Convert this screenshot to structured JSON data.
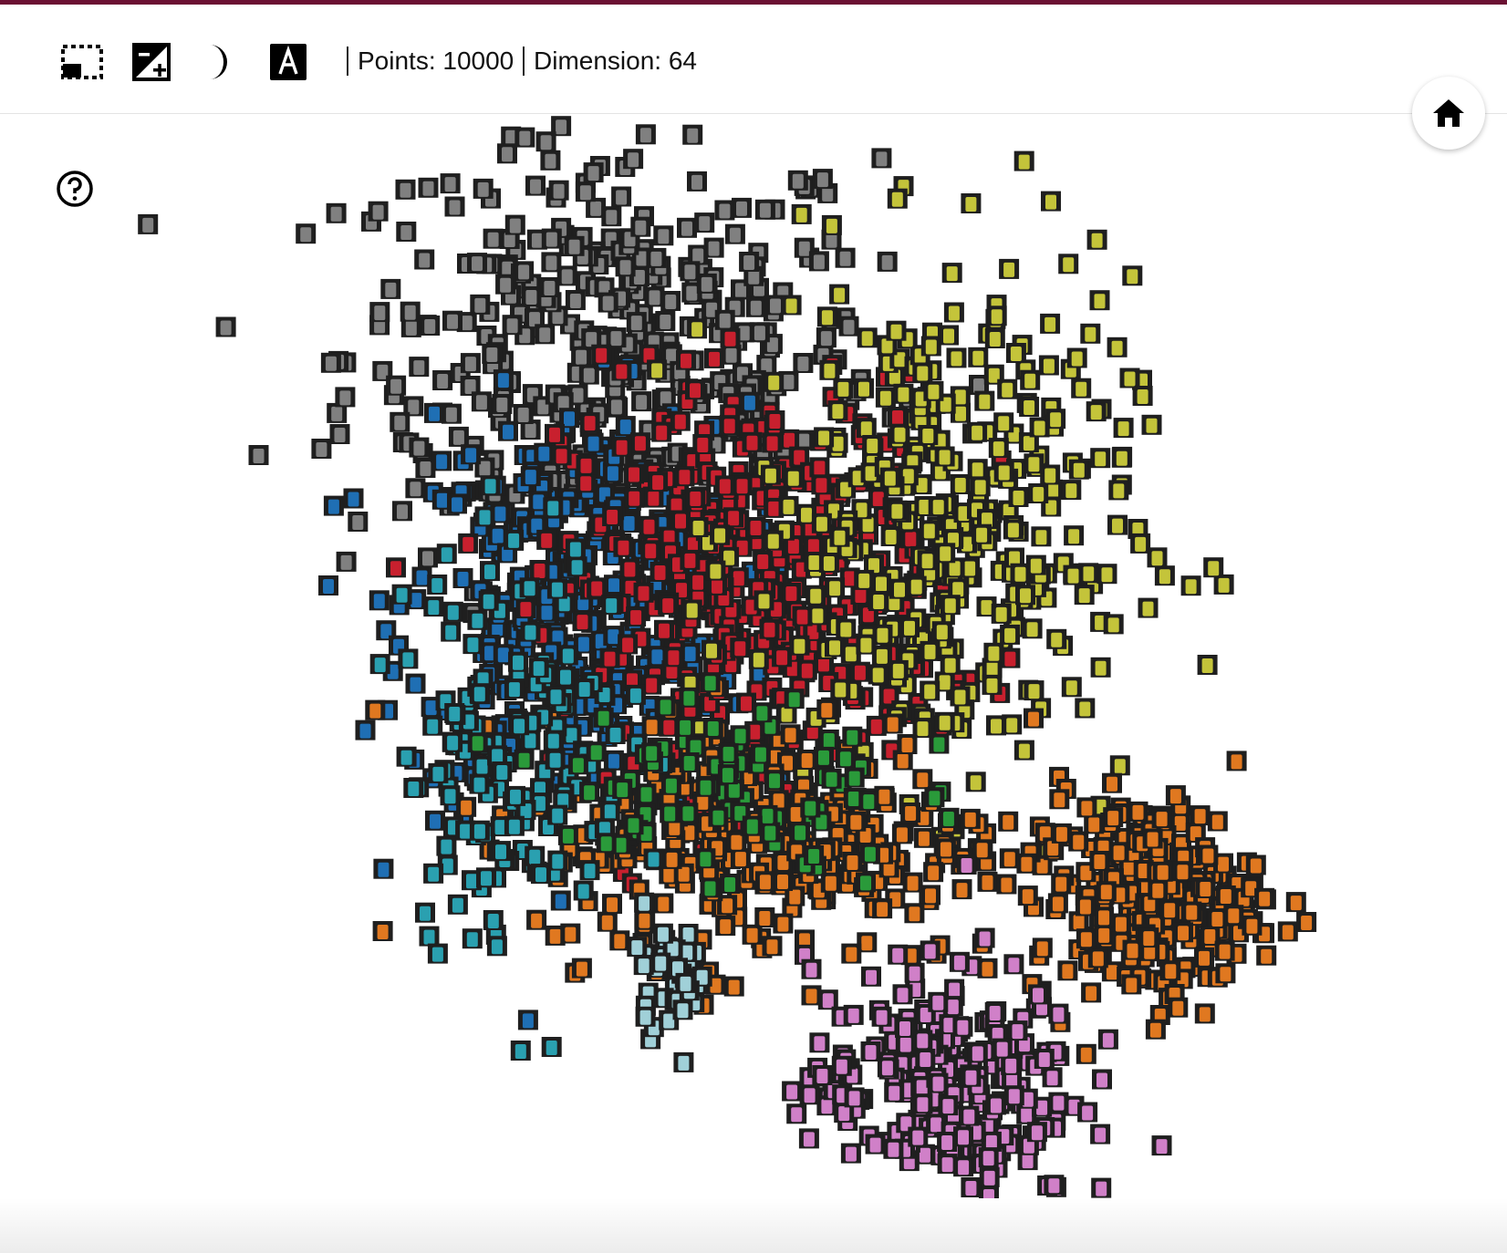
{
  "toolbar": {
    "buttons": [
      {
        "name": "select-region",
        "icon": "dashed-rectangle-icon"
      },
      {
        "name": "toggle-contrast",
        "icon": "exposure-plus-icon"
      },
      {
        "name": "night-mode",
        "icon": "crescent-moon-icon"
      },
      {
        "name": "toggle-labels",
        "icon": "label-a-icon"
      }
    ],
    "points_label": "Points: 10000",
    "dimension_label": "Dimension: 64"
  },
  "home_button": {
    "icon": "home-icon"
  },
  "help_button": {
    "icon": "help-circle-icon"
  },
  "colors": {
    "accent": "#6b1133",
    "tile_background": "#1f1f1f"
  },
  "chart_data": {
    "type": "scatter",
    "description_visible": "",
    "series": [
      {
        "color": "#808080",
        "center": [
          -0.35,
          0.55
        ],
        "spread": [
          0.28,
          0.22
        ],
        "count": 420
      },
      {
        "color": "#1f6fb4",
        "center": [
          -0.42,
          0.05
        ],
        "spread": [
          0.18,
          0.2
        ],
        "count": 380
      },
      {
        "color": "#c8202e",
        "center": [
          -0.05,
          0.1
        ],
        "spread": [
          0.2,
          0.2
        ],
        "count": 420
      },
      {
        "color": "#c4c43a",
        "center": [
          0.35,
          0.2
        ],
        "spread": [
          0.2,
          0.25
        ],
        "count": 380
      },
      {
        "color": "#e07820",
        "center": [
          0.0,
          -0.4
        ],
        "spread": [
          0.25,
          0.12
        ],
        "count": 300
      },
      {
        "color": "#e07820",
        "center": [
          0.78,
          -0.52
        ],
        "spread": [
          0.12,
          0.1
        ],
        "count": 260
      },
      {
        "color": "#d080c8",
        "center": [
          0.35,
          -0.88
        ],
        "spread": [
          0.14,
          0.12
        ],
        "count": 250
      },
      {
        "color": "#2aa0b0",
        "center": [
          -0.55,
          -0.2
        ],
        "spread": [
          0.12,
          0.2
        ],
        "count": 160
      },
      {
        "color": "#2a9a3a",
        "center": [
          -0.1,
          -0.3
        ],
        "spread": [
          0.18,
          0.1
        ],
        "count": 90
      },
      {
        "color": "#a0d0d8",
        "center": [
          -0.22,
          -0.65
        ],
        "spread": [
          0.04,
          0.06
        ],
        "count": 40
      }
    ]
  }
}
